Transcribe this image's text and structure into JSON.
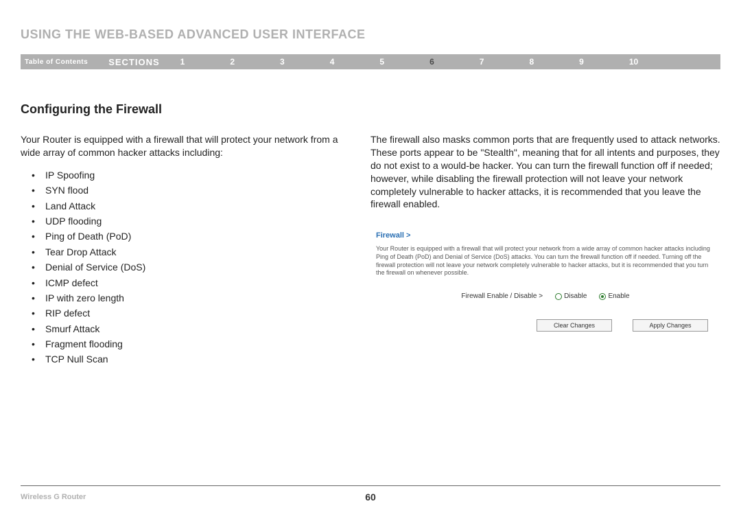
{
  "page_title": "USING THE WEB-BASED ADVANCED USER INTERFACE",
  "nav": {
    "toc": "Table of Contents",
    "sections_label": "SECTIONS",
    "numbers": [
      "1",
      "2",
      "3",
      "4",
      "5",
      "6",
      "7",
      "8",
      "9",
      "10"
    ],
    "active": "6"
  },
  "section_heading": "Configuring the Firewall",
  "left": {
    "intro": "Your Router is equipped with a firewall that will protect your network from a wide array of common hacker attacks including:",
    "attacks": [
      "IP Spoofing",
      "SYN flood",
      "Land Attack",
      "UDP flooding",
      "Ping of Death (PoD)",
      "Tear Drop Attack",
      "Denial of Service (DoS)",
      "ICMP defect",
      "IP with zero length",
      "RIP defect",
      "Smurf Attack",
      "Fragment flooding",
      "TCP Null Scan"
    ]
  },
  "right": {
    "para": "The firewall also masks common ports that are frequently used to attack networks. These ports appear to be \"Stealth\", meaning that for all intents and purposes, they do not exist to a would-be hacker. You can turn the firewall function off if needed; however, while disabling the firewall protection will not leave your network completely vulnerable to hacker attacks, it is recommended that you leave the firewall enabled.",
    "panel": {
      "title": "Firewall >",
      "desc": "Your Router is equipped with a firewall that will protect your network from a wide array of common hacker attacks including Ping of Death (PoD) and Denial of Service (DoS) attacks. You can turn the firewall function off if needed. Turning off the firewall protection will not leave your network completely vulnerable to hacker attacks, but it is recommended that you turn the firewall on whenever possible.",
      "row_label": "Firewall Enable / Disable >",
      "disable": "Disable",
      "enable": "Enable",
      "clear": "Clear Changes",
      "apply": "Apply Changes"
    }
  },
  "footer": {
    "left": "Wireless G Router",
    "page": "60"
  }
}
